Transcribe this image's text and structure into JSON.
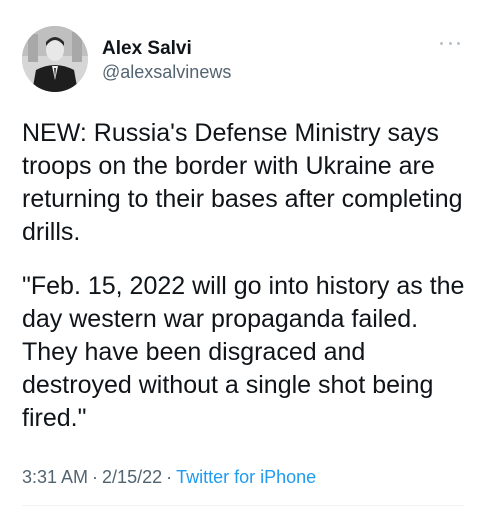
{
  "author": {
    "display_name": "Alex Salvi",
    "handle": "@alexsalvinews",
    "avatar_icon": "profile-photo"
  },
  "more_icon": "ellipsis-icon",
  "tweet": {
    "paragraph_1": "NEW: Russia's Defense Ministry says troops on the border with Ukraine are returning to their bases after completing drills.",
    "paragraph_2": "\"Feb. 15, 2022 will go into history as the day western war propaganda failed. They have been disgraced and destroyed without a single shot being fired.\""
  },
  "meta": {
    "time": "3:31 AM",
    "separator": "·",
    "date": "2/15/22",
    "source": "Twitter for iPhone"
  },
  "colors": {
    "text": "#0f1419",
    "secondary": "#536471",
    "link": "#1d9bf0"
  }
}
